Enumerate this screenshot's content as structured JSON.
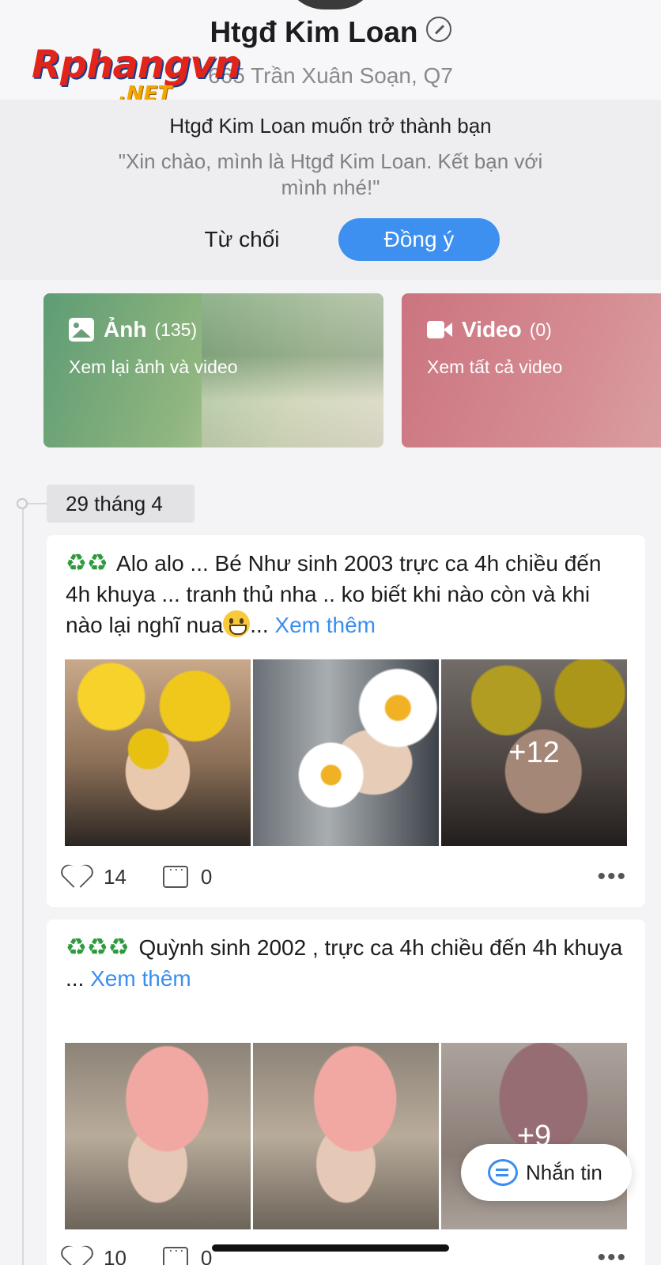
{
  "profile": {
    "name": "Htgđ Kim Loan",
    "address": "665 Trần Xuân Soạn, Q7"
  },
  "watermark": {
    "main": "Rphangvn",
    "sub": ".NET"
  },
  "friend_request": {
    "title": "Htgđ Kim Loan muốn trở thành bạn",
    "message": "\"Xin chào, mình là Htgđ Kim Loan. Kết bạn với mình nhé!\"",
    "decline_label": "Từ chối",
    "accept_label": "Đồng ý"
  },
  "media": {
    "photos": {
      "label": "Ảnh",
      "count": "(135)",
      "subtitle": "Xem lại ảnh và video",
      "icon": "photo-icon"
    },
    "videos": {
      "label": "Video",
      "count": "(0)",
      "subtitle": "Xem tất cả video",
      "icon": "video-camera-icon"
    }
  },
  "timeline": {
    "date": "29 tháng 4",
    "posts": [
      {
        "emojis": "♻♻",
        "text": "Alo alo ... Bé Như sinh 2003 trực ca 4h chiều đến 4h khuya ... tranh thủ nha .. ko biết khi nào còn và khi nào lại nghĩ nua",
        "ellipsis": "...",
        "see_more": "Xem thêm",
        "more_photos": "+12",
        "likes": "14",
        "comments": "0"
      },
      {
        "emojis": "♻♻♻",
        "text": "Quỳnh sinh 2002 , trực ca 4h chiều đến 4h khuya",
        "ellipsis": "...",
        "see_more": "Xem thêm",
        "more_photos": "+9",
        "likes": "10",
        "comments": "0"
      }
    ]
  },
  "message_button": {
    "label": "Nhắn tin",
    "icon": "chat-bubble-icon"
  },
  "colors": {
    "accent": "#3d8ff0",
    "photo_card": "#5e9c74",
    "video_card": "#cb7480",
    "link": "#3a8ef0"
  }
}
